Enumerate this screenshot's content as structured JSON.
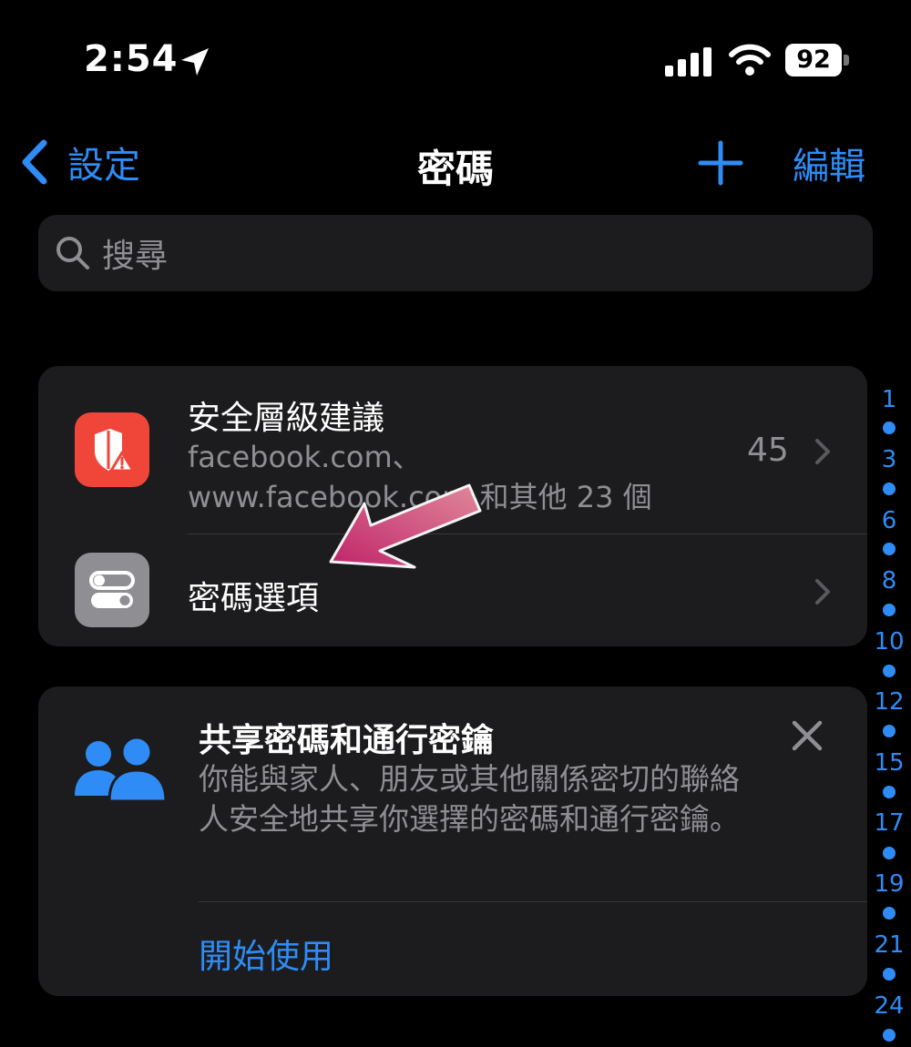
{
  "status_bar": {
    "time": "2:54",
    "battery": "92"
  },
  "nav": {
    "back_label": "設定",
    "title": "密碼",
    "edit_label": "編輯"
  },
  "search": {
    "placeholder": "搜尋"
  },
  "security": {
    "title": "安全層級建議",
    "subtitle_line1": "facebook.com、",
    "subtitle_line2": "www.facebook.com 和其他 23 個",
    "count": "45"
  },
  "options": {
    "title": "密碼選項"
  },
  "share_card": {
    "title": "共享密碼和通行密鑰",
    "description": "你能與家人、朋友或其他關係密切的聯絡人安全地共享你選擇的密碼和通行密鑰。",
    "action_label": "開始使用"
  },
  "index_strip": {
    "labels": [
      "1",
      "3",
      "6",
      "8",
      "10",
      "12",
      "15",
      "17",
      "19",
      "21",
      "24"
    ]
  },
  "colors": {
    "accent": "#2f8cf6",
    "security_icon_bg": "#f0463a",
    "annotation_arrow": "#c83c78"
  }
}
